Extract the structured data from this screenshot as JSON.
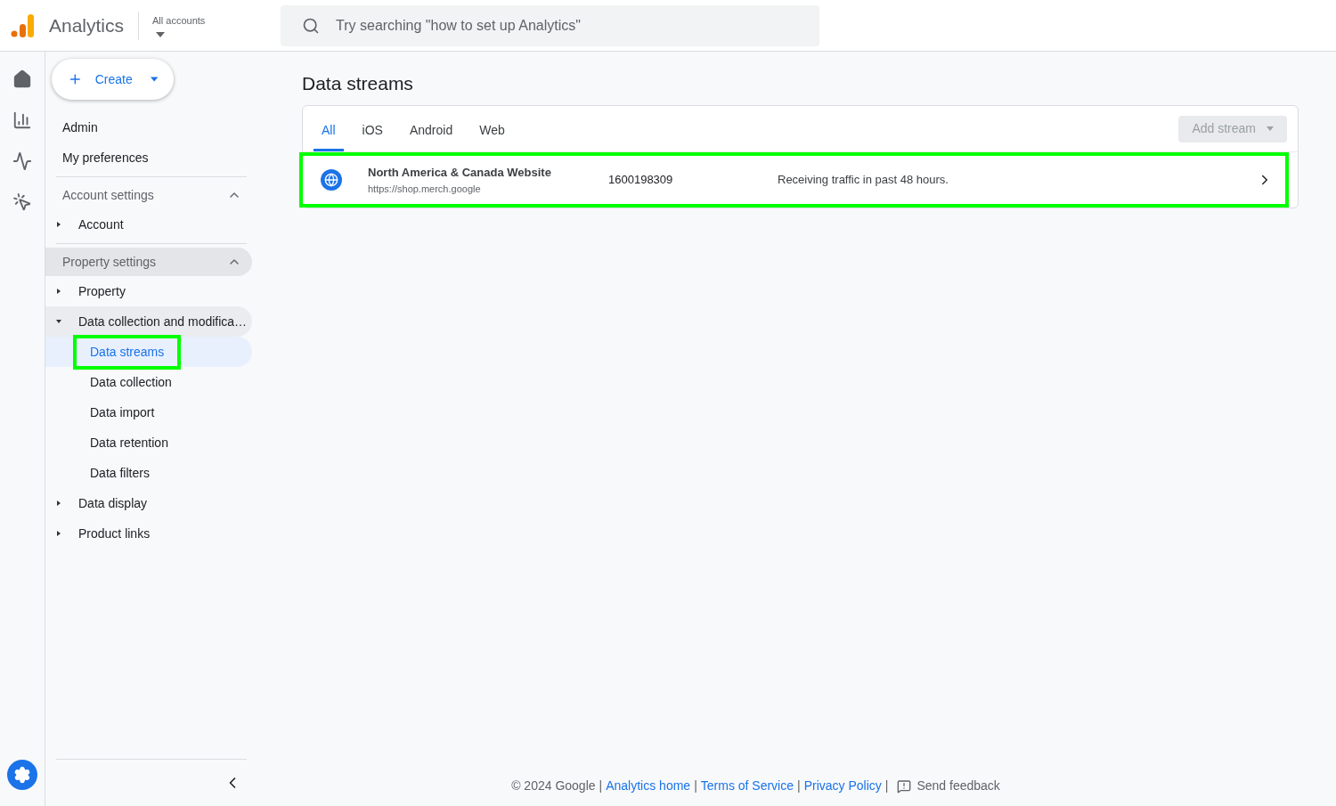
{
  "header": {
    "product": "Analytics",
    "account_switcher": "All accounts",
    "search": {
      "placeholder": "Try searching \"how to set up Analytics\""
    }
  },
  "create_button": "Create",
  "sidebar": {
    "top_items": [
      {
        "label": "Admin",
        "selected": false
      },
      {
        "label": "My preferences",
        "selected": false
      }
    ],
    "sections": [
      {
        "title": "Account settings",
        "expanded": true,
        "highlighted": false,
        "items": [
          {
            "label": "Account",
            "expanded": false,
            "selected": false
          }
        ]
      },
      {
        "title": "Property settings",
        "expanded": true,
        "highlighted": true,
        "items": [
          {
            "label": "Property",
            "expanded": false,
            "selected": false
          },
          {
            "label": "Data collection and modifica…",
            "expanded": true,
            "selected": false,
            "children": [
              {
                "label": "Data streams",
                "selected": true,
                "annotated": true
              },
              {
                "label": "Data collection",
                "selected": false,
                "annotated": false
              },
              {
                "label": "Data import",
                "selected": false,
                "annotated": false
              },
              {
                "label": "Data retention",
                "selected": false,
                "annotated": false
              },
              {
                "label": "Data filters",
                "selected": false,
                "annotated": false
              }
            ]
          },
          {
            "label": "Data display",
            "expanded": false,
            "selected": false
          },
          {
            "label": "Product links",
            "expanded": false,
            "selected": false
          }
        ]
      }
    ]
  },
  "page": {
    "title": "Data streams",
    "tabs": [
      {
        "label": "All",
        "selected": true
      },
      {
        "label": "iOS",
        "selected": false
      },
      {
        "label": "Android",
        "selected": false
      },
      {
        "label": "Web",
        "selected": false
      }
    ],
    "add_stream": {
      "label": "Add stream",
      "disabled": true
    },
    "streams": [
      {
        "name": "North America & Canada Website",
        "url": "https://shop.merch.google",
        "id": "1600198309",
        "status": "Receiving traffic in past 48 hours.",
        "annotated": true
      }
    ]
  },
  "footer": [
    {
      "kind": "text",
      "text": "© 2024 Google"
    },
    {
      "kind": "sep",
      "text": "|"
    },
    {
      "kind": "link",
      "text": "Analytics home"
    },
    {
      "kind": "sep",
      "text": "|"
    },
    {
      "kind": "link",
      "text": "Terms of Service"
    },
    {
      "kind": "sep",
      "text": "|"
    },
    {
      "kind": "link",
      "text": "Privacy Policy"
    },
    {
      "kind": "sep",
      "text": "|"
    },
    {
      "kind": "feedback",
      "text": "Send feedback"
    }
  ]
}
